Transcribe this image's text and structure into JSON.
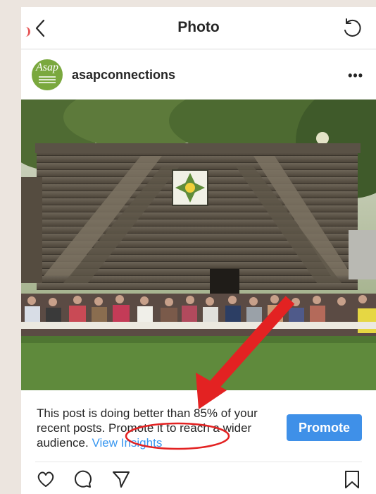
{
  "header": {
    "title": "Photo"
  },
  "post": {
    "username": "asapconnections",
    "avatar_text": "Asap"
  },
  "insights": {
    "message": "This post is doing better than 85% of your recent posts. Promote it to reach a wider audience.",
    "link_label": "View Insights",
    "promote_label": "Promote"
  },
  "icons": [
    "back-icon",
    "refresh-icon",
    "more-icon",
    "heart-icon",
    "comment-icon",
    "share-icon",
    "bookmark-icon"
  ],
  "colors": {
    "accent": "#3897f0",
    "promote": "#3f90e8",
    "annotation": "#e32222"
  }
}
